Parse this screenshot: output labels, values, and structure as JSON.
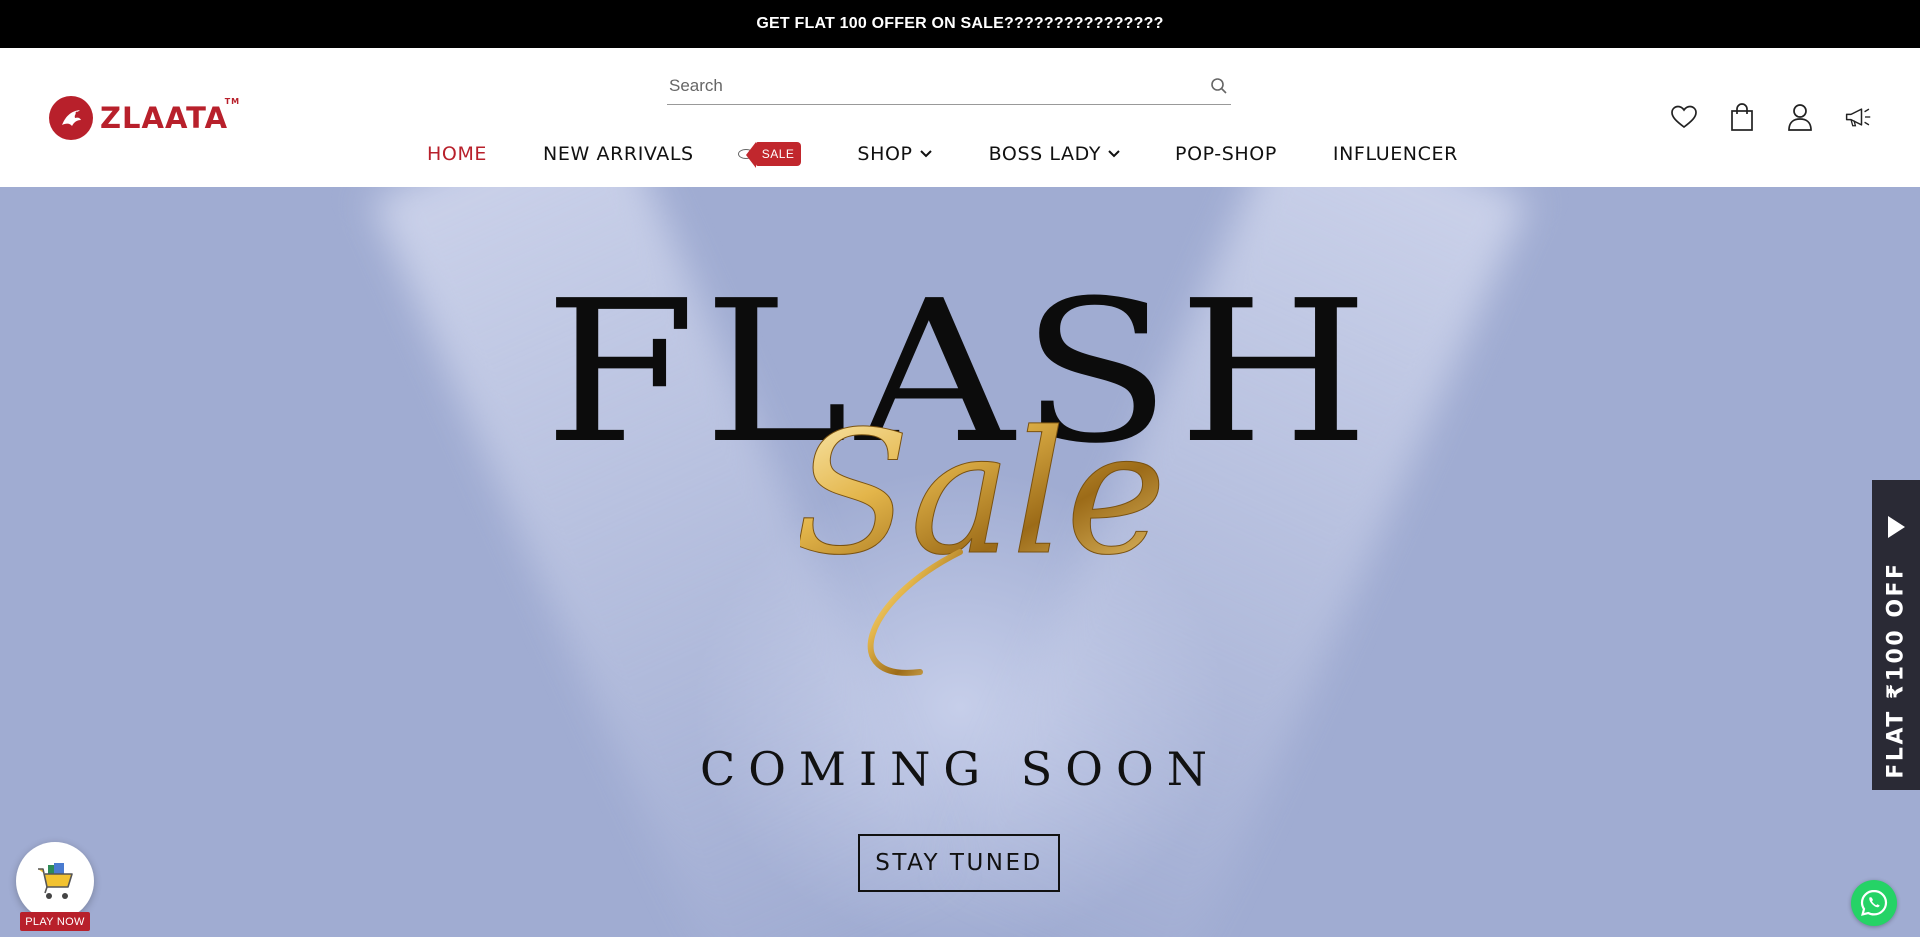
{
  "announcement": {
    "text": "GET FLAT 100 OFFER ON SALE????????????????"
  },
  "brand": {
    "name": "ZLAATA",
    "tm": "TM"
  },
  "search": {
    "placeholder": "Search"
  },
  "nav": {
    "items": [
      {
        "label": "HOME",
        "active": true
      },
      {
        "label": "NEW ARRIVALS"
      },
      {
        "label": "SALE",
        "badge": true
      },
      {
        "label": "SHOP",
        "dropdown": true
      },
      {
        "label": "BOSS LADY",
        "dropdown": true
      },
      {
        "label": "POP-SHOP"
      },
      {
        "label": "INFLUENCER"
      }
    ]
  },
  "header_icons": [
    "heart-icon",
    "shopping-bag-icon",
    "user-icon",
    "megaphone-icon"
  ],
  "hero": {
    "headline": "FLASH",
    "script": "Sale",
    "subtitle": "COMING SOON",
    "cta": "STAY TUNED"
  },
  "side_offer": {
    "text": "FLAT ₹100 OFF"
  },
  "play_widget": {
    "label": "PLAY NOW"
  },
  "colors": {
    "brand_red": "#b8202b",
    "hero_bg": "#a0acd2",
    "whatsapp": "#25d366",
    "side_tab": "#2a2a35"
  }
}
